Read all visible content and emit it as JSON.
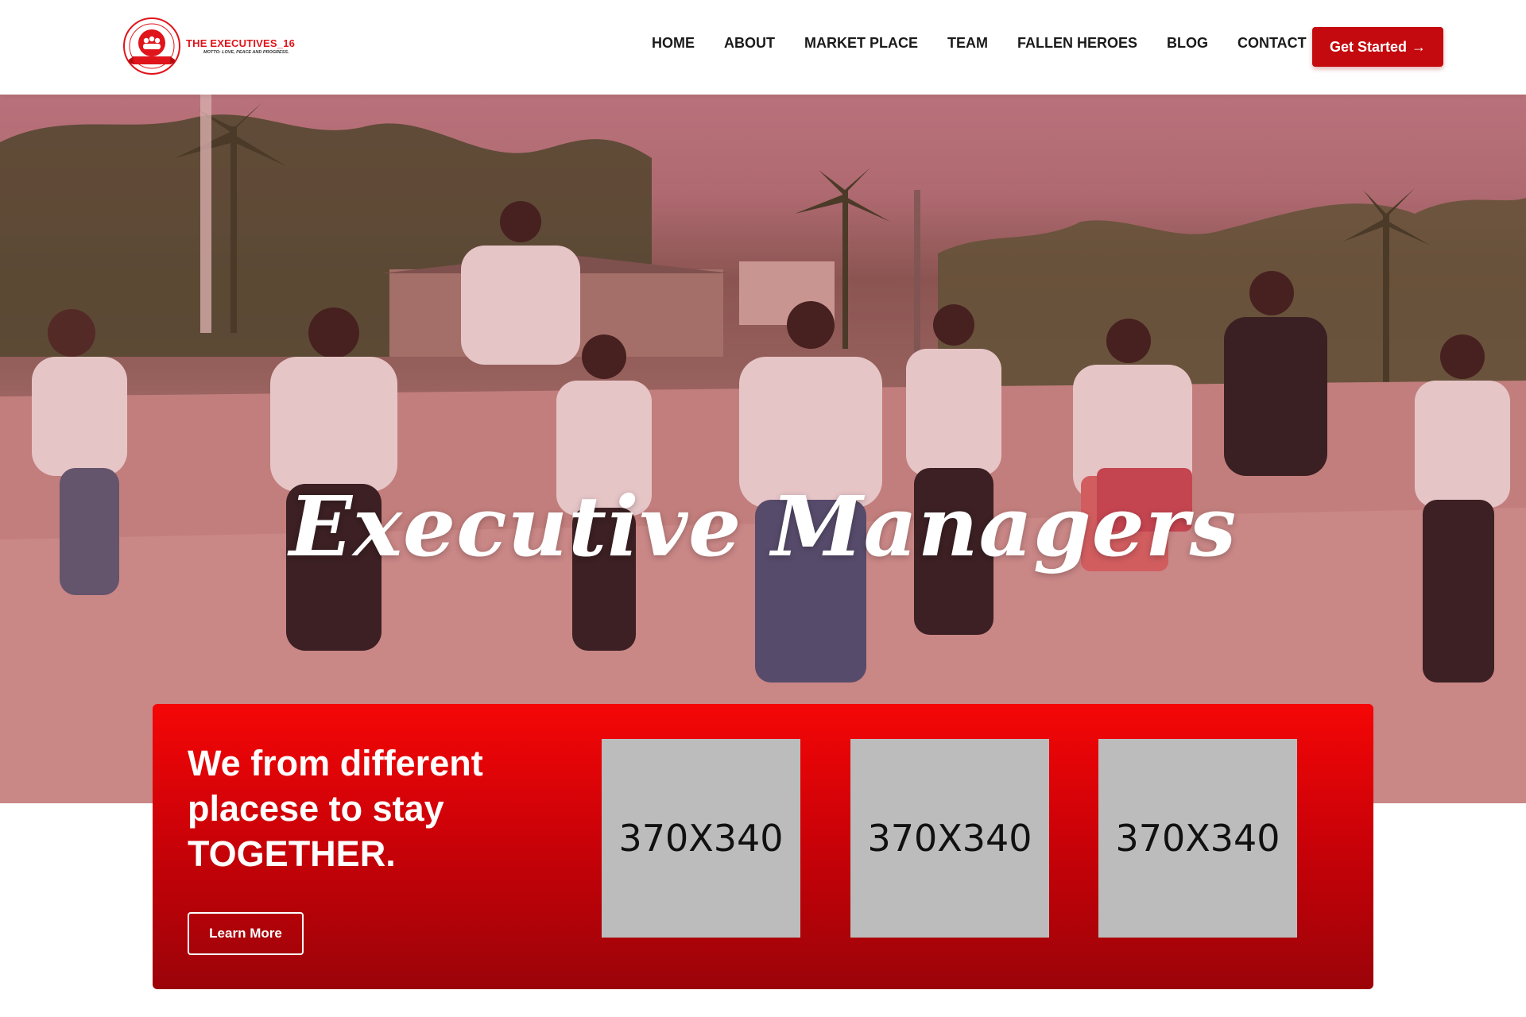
{
  "header": {
    "logo": {
      "name": "THE EXECUTIVES_16",
      "motto": "MOTTO: LOVE, PEACE AND PROGRESS."
    },
    "nav": [
      {
        "label": "HOME"
      },
      {
        "label": "ABOUT"
      },
      {
        "label": "MARKET PLACE"
      },
      {
        "label": "TEAM"
      },
      {
        "label": "FALLEN HEROES"
      },
      {
        "label": "BLOG"
      },
      {
        "label": "CONTACT"
      }
    ],
    "cta": {
      "label": "Get Started",
      "icon": "arrow-right-icon"
    }
  },
  "hero": {
    "title": "Executive Managers"
  },
  "promo": {
    "heading": "We from different placese to stay TOGETHER.",
    "button_label": "Learn More",
    "placeholders": [
      {
        "label": "370X340"
      },
      {
        "label": "370X340"
      },
      {
        "label": "370X340"
      }
    ]
  },
  "colors": {
    "brand_red": "#c40a0e",
    "promo_top": "#f50606",
    "promo_bottom": "#9b0309",
    "placeholder_gray": "#bcbcbc"
  }
}
